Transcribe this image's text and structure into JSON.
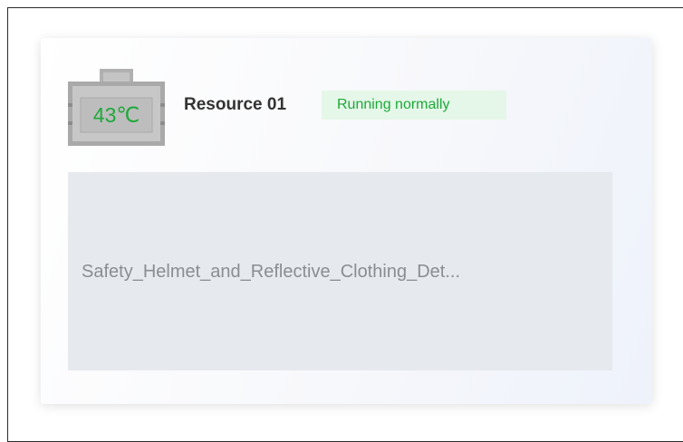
{
  "resource": {
    "temperature": "43℃",
    "name": "Resource 01",
    "status": "Running normally"
  },
  "task": {
    "name": "Safety_Helmet_and_Reflective_Clothing_Det..."
  },
  "colors": {
    "status_green": "#1ea93a",
    "status_bg": "#e5f7e8",
    "chip_gray": "#a8a8a8",
    "panel_bg": "#e6e9ee"
  },
  "icons": {
    "chip": "chip-icon"
  }
}
